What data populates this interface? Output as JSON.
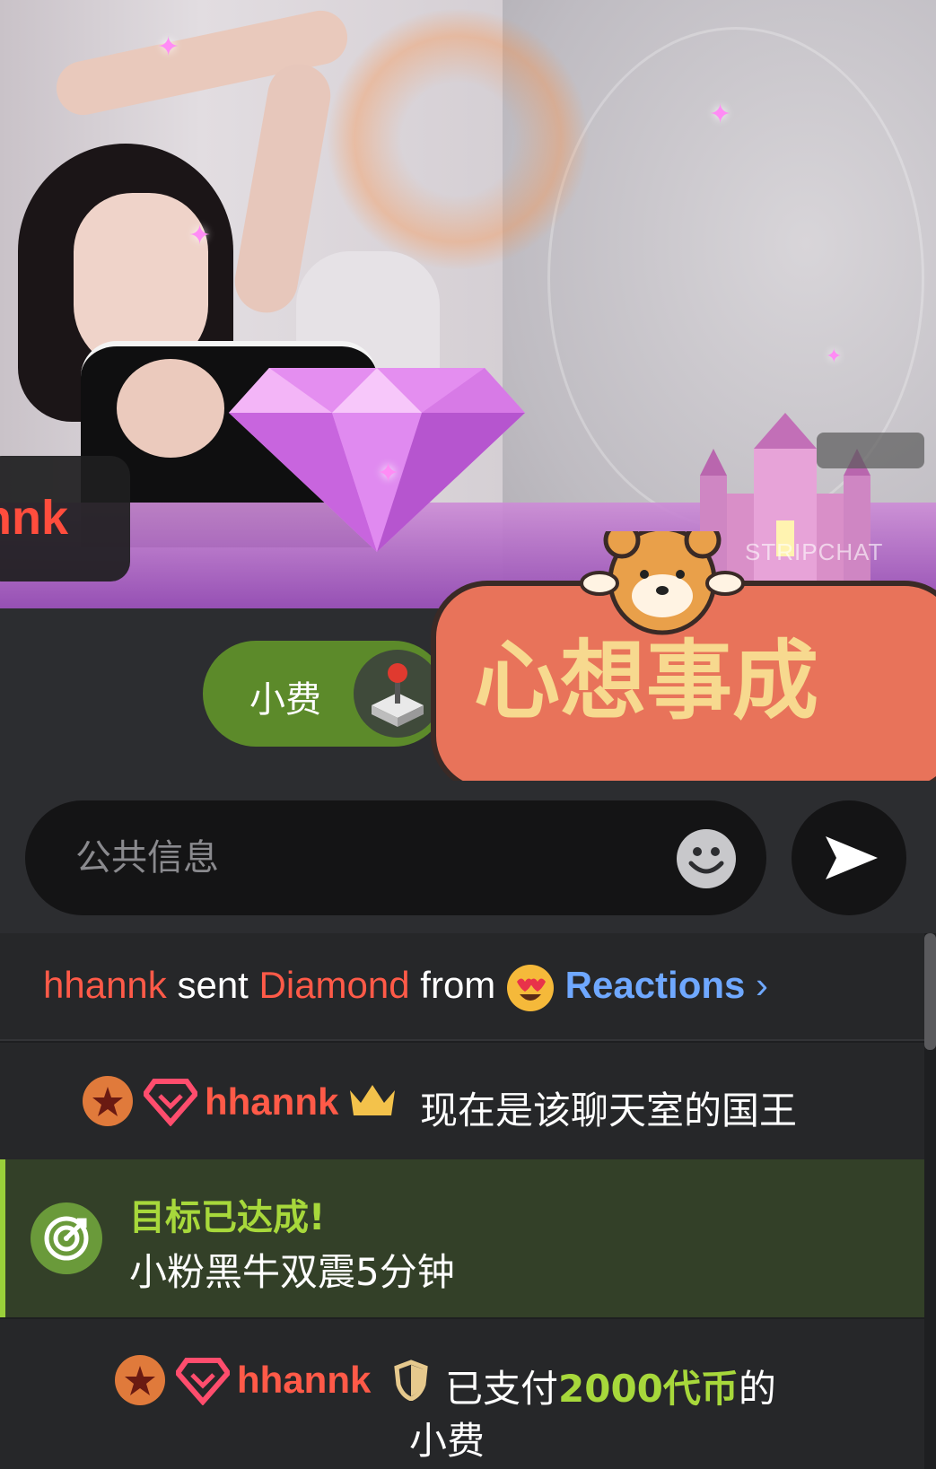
{
  "video": {
    "watermark": "STRIPCHAT",
    "overlay_username": "nnk"
  },
  "tip_bar": {
    "tip_label": "小费",
    "sticker_text": "心想事成"
  },
  "input": {
    "placeholder": "公共信息"
  },
  "chat": {
    "messages": [
      {
        "user": "hhannk",
        "verb": "sent",
        "item": "Diamond",
        "from": "from",
        "source": "Reactions"
      },
      {
        "user": "hhannk",
        "text": "现在是该聊天室的国王"
      },
      {
        "title": "目标已达成!",
        "text": "小粉黑牛双震5分钟"
      },
      {
        "user": "hhannk",
        "prefix": "已支付",
        "amount": "2000代币",
        "suffix": "的",
        "line2": "小费"
      }
    ]
  },
  "colors": {
    "username": "#ff5a48",
    "tip_green": "#5c8a2a",
    "goal_green": "#a7d83b",
    "link_blue": "#6fa8ff"
  }
}
